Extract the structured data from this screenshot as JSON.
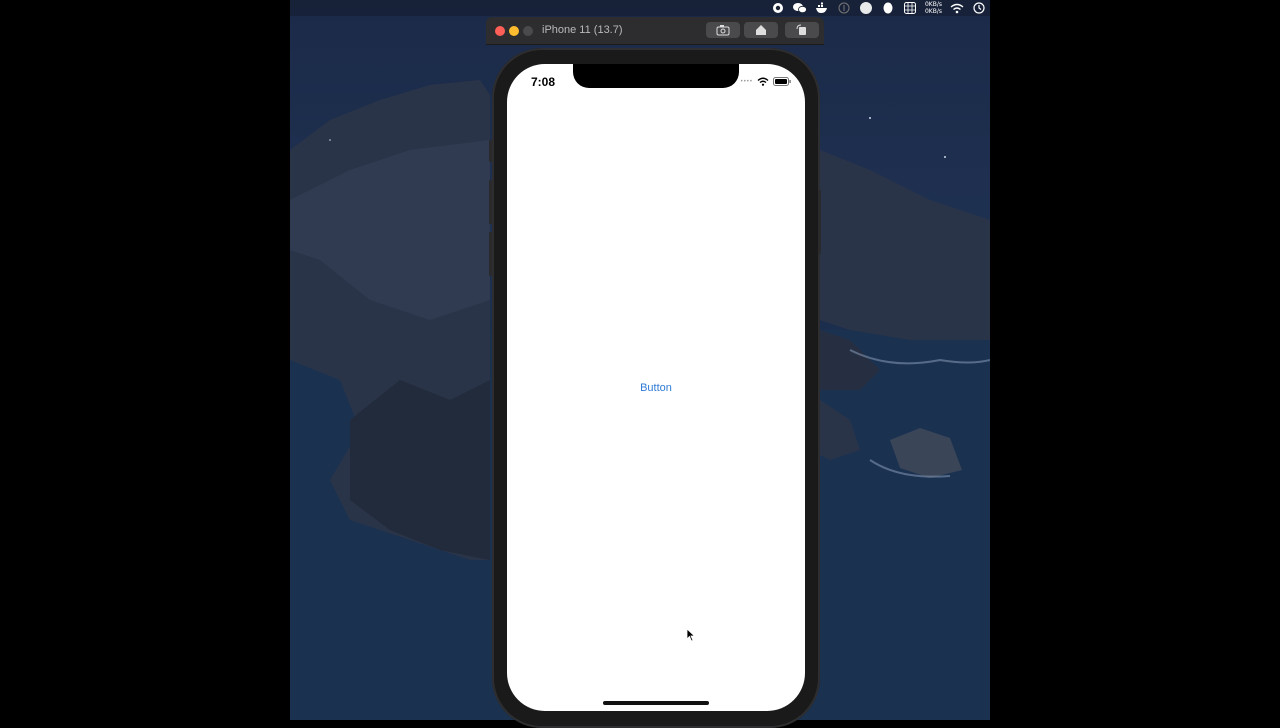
{
  "window": {
    "title": "iPhone 11 (13.7)",
    "toolbar": [
      {
        "name": "screenshot-button",
        "icon": "camera-icon"
      },
      {
        "name": "home-button",
        "icon": "home-icon"
      },
      {
        "name": "rotate-button",
        "icon": "rotate-icon"
      }
    ]
  },
  "menubar": {
    "net_up": "0KB/s",
    "net_down": "0KB/s",
    "icons": [
      "record-icon",
      "wechat-icon",
      "docker-icon",
      "dollar-icon",
      "pinwheel-icon",
      "qq-penguin-icon",
      "grid-icon",
      "wifi-icon",
      "time-machine-icon"
    ]
  },
  "device": {
    "status_time": "7:08",
    "button_label": "Button"
  },
  "colors": {
    "accent": "#2f7bd6",
    "desktop": "#1b2a48",
    "screen": "#ffffff"
  }
}
